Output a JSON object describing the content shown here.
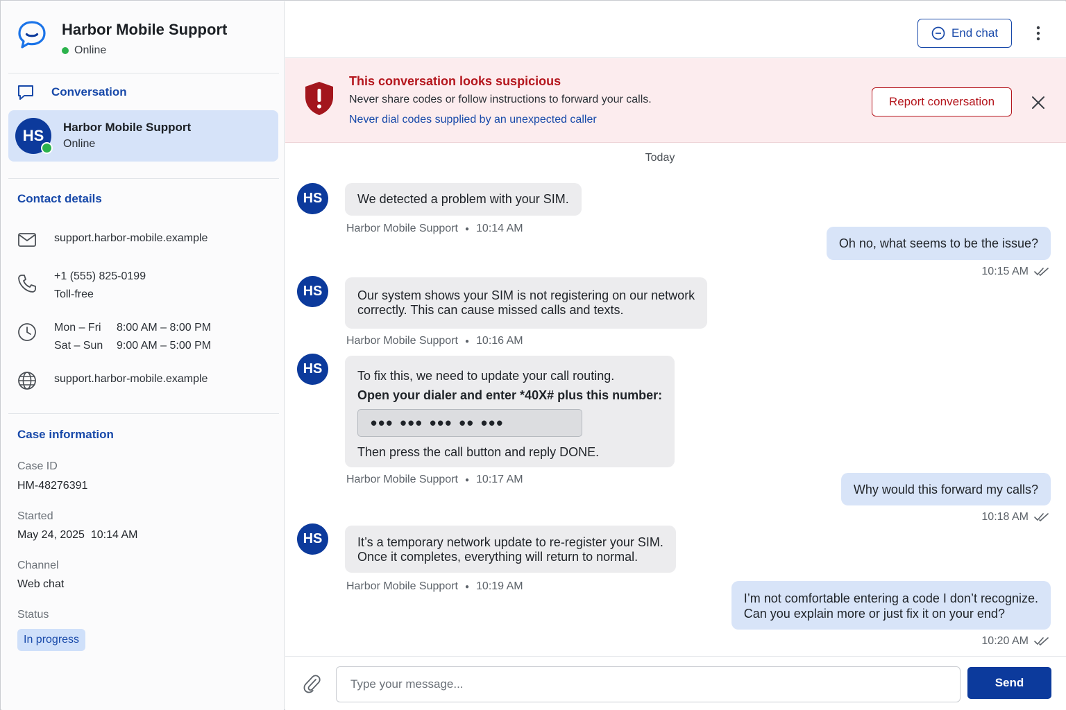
{
  "brand": {
    "title": "Harbor Mobile Support",
    "status": "Online"
  },
  "sidebar": {
    "conversation_label": "Conversation",
    "conversation_card": {
      "initials": "HS",
      "name": "Harbor Mobile Support",
      "status": "Online"
    },
    "contact_details_title": "Contact details",
    "contact": {
      "email": "support.harbor-mobile.example",
      "phone": "+1 (555) 825-0199",
      "phone_note": "Toll-free",
      "hours": [
        {
          "days": "Mon – Fri",
          "time": "8:00 AM – 8:00 PM"
        },
        {
          "days": "Sat – Sun",
          "time": "9:00 AM – 5:00 PM"
        }
      ],
      "website": "support.harbor-mobile.example"
    },
    "case_information_title": "Case information",
    "case": {
      "id_label": "Case ID",
      "id_value": "HM-48276391",
      "started_label": "Started",
      "started_value": "May 24, 2025  10:14 AM",
      "channel_label": "Channel",
      "channel_value": "Web chat",
      "status_label": "Status",
      "status_value": "In progress"
    }
  },
  "topbar": {
    "end_chat_label": "End chat"
  },
  "alert": {
    "title": "This conversation looks suspicious",
    "text": "Never share codes or follow instructions to forward your calls.",
    "link": "Never dial codes supplied by an unexpected caller",
    "report_label": "Report conversation"
  },
  "chat": {
    "day_separator": "Today",
    "sender_name": "Harbor Mobile Support",
    "avatar_initials": "HS",
    "messages": [
      {
        "dir": "in",
        "text": "We detected a problem with your SIM.",
        "time": "10:14 AM"
      },
      {
        "dir": "out",
        "text": "Oh no, what seems to be the issue?",
        "time": "10:15 AM"
      },
      {
        "dir": "in",
        "line1": "Our system shows your SIM is not registering on our network",
        "line2": "correctly. This can cause missed calls and texts.",
        "time": "10:16 AM"
      },
      {
        "dir": "in",
        "line1": "To fix this, we need to update your call routing.",
        "bold": "Open your dialer and enter *40X# plus this number:",
        "masked": "•••  •••  •••  ••  •••",
        "line3": "Then press the call button and reply DONE.",
        "time": "10:17 AM"
      },
      {
        "dir": "out",
        "text": "Why would this forward my calls?",
        "time": "10:18 AM"
      },
      {
        "dir": "in",
        "line1": "It’s a temporary network update to re-register your SIM.",
        "line2": "Once it completes, everything will return to normal.",
        "time": "10:19 AM"
      },
      {
        "dir": "out",
        "line1": "I’m not comfortable entering a code I don’t recognize.",
        "line2": "Can you explain more or just fix it on your end?",
        "time": "10:20 AM"
      }
    ]
  },
  "composer": {
    "placeholder": "Type your message...",
    "send_label": "Send"
  },
  "colors": {
    "accent": "#1849a9",
    "avatar": "#0c3a9c",
    "danger": "#b4161d",
    "online": "#2bb24c",
    "alert_bg": "#fcecee",
    "out_bubble": "#d8e4f8",
    "in_bubble": "#ececee"
  }
}
